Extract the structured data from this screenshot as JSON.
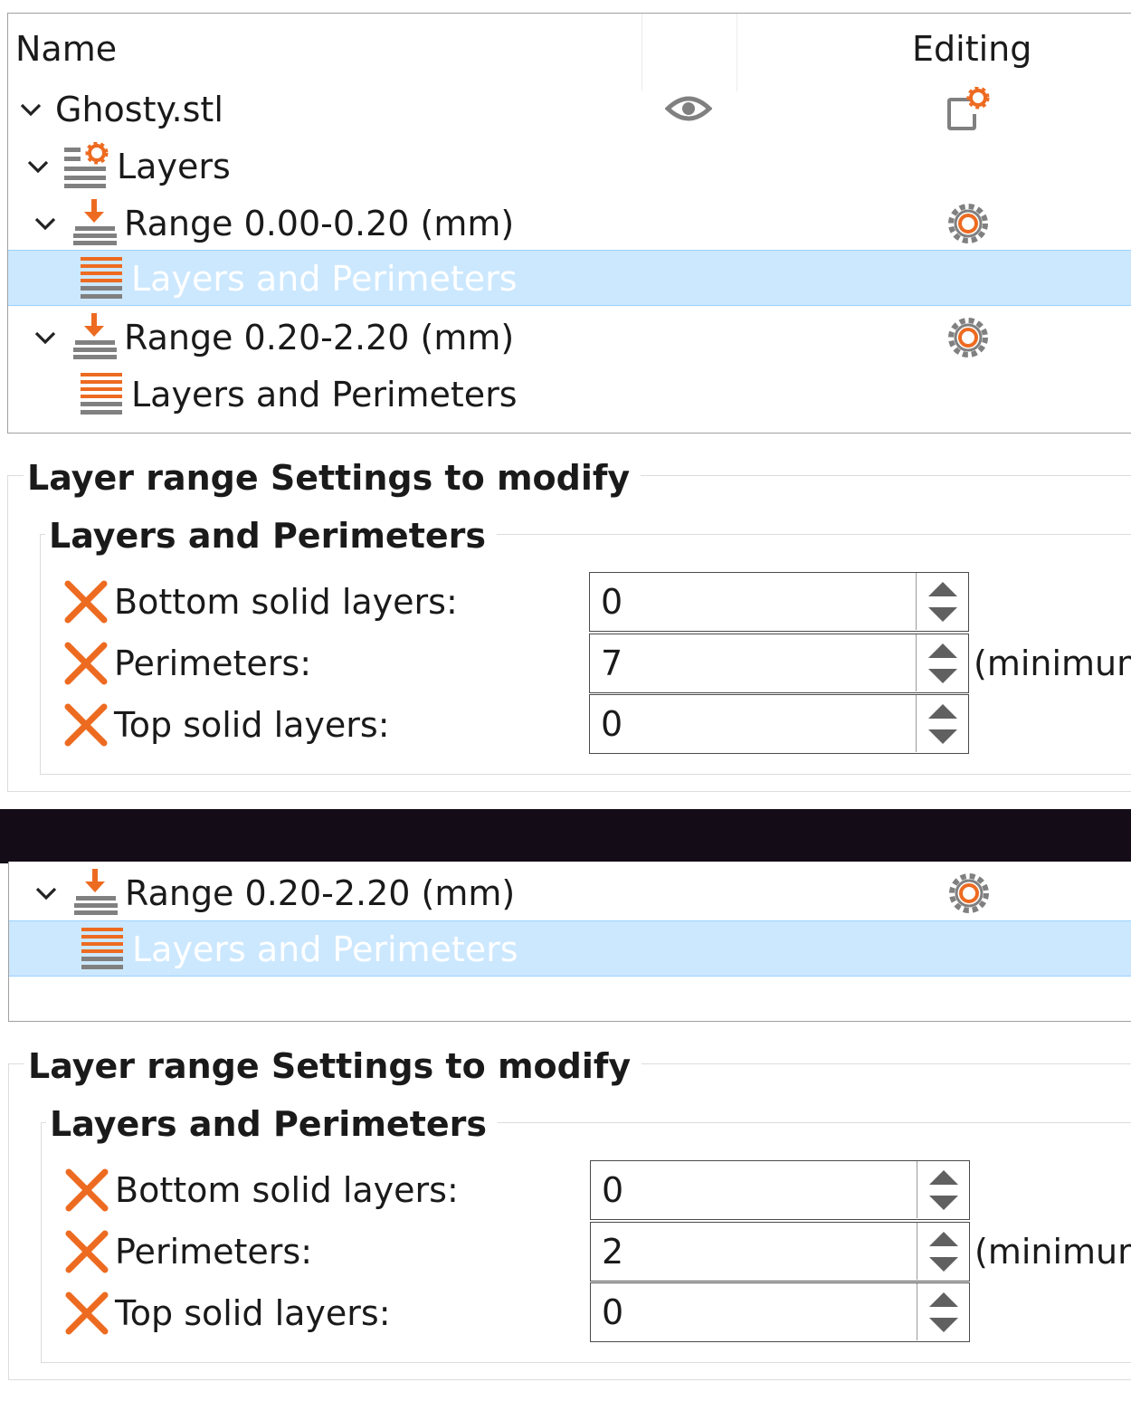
{
  "object_list": {
    "columns": {
      "name": "Name",
      "editing": "Editing"
    },
    "rows": [
      {
        "label": "Ghosty.stl"
      },
      {
        "label": "Layers"
      },
      {
        "label": "Range 0.00-0.20 (mm)"
      },
      {
        "label": "Layers and Perimeters"
      },
      {
        "label": "Range 0.20-2.20 (mm)"
      },
      {
        "label": "Layers and Perimeters"
      }
    ]
  },
  "settings_1": {
    "title": "Layer range Settings to modify",
    "group": "Layers and Perimeters",
    "options": [
      {
        "label": "Bottom solid layers:",
        "value": "0"
      },
      {
        "label": "Perimeters:",
        "value": "7",
        "suffix": "(minimum"
      },
      {
        "label": "Top solid layers:",
        "value": "0"
      }
    ]
  },
  "object_list_2": {
    "rows": [
      {
        "label": "Range 0.20-2.20 (mm)"
      },
      {
        "label": "Layers and Perimeters"
      }
    ]
  },
  "settings_2": {
    "title": "Layer range Settings to modify",
    "group": "Layers and Perimeters",
    "options": [
      {
        "label": "Bottom solid layers:",
        "value": "0"
      },
      {
        "label": "Perimeters:",
        "value": "2",
        "suffix": "(minimum"
      },
      {
        "label": "Top solid layers:",
        "value": "0"
      }
    ]
  },
  "colors": {
    "accent": "#ed6b21",
    "selection": "#cce8ff",
    "icon_gray": "#808080"
  },
  "icons": [
    "chevron-down-icon",
    "eye-icon",
    "edit-settings-icon",
    "layers-settings-icon",
    "range-icon",
    "gear-icon",
    "layers-perimeters-icon",
    "remove-x-icon",
    "spin-up-icon",
    "spin-down-icon"
  ]
}
